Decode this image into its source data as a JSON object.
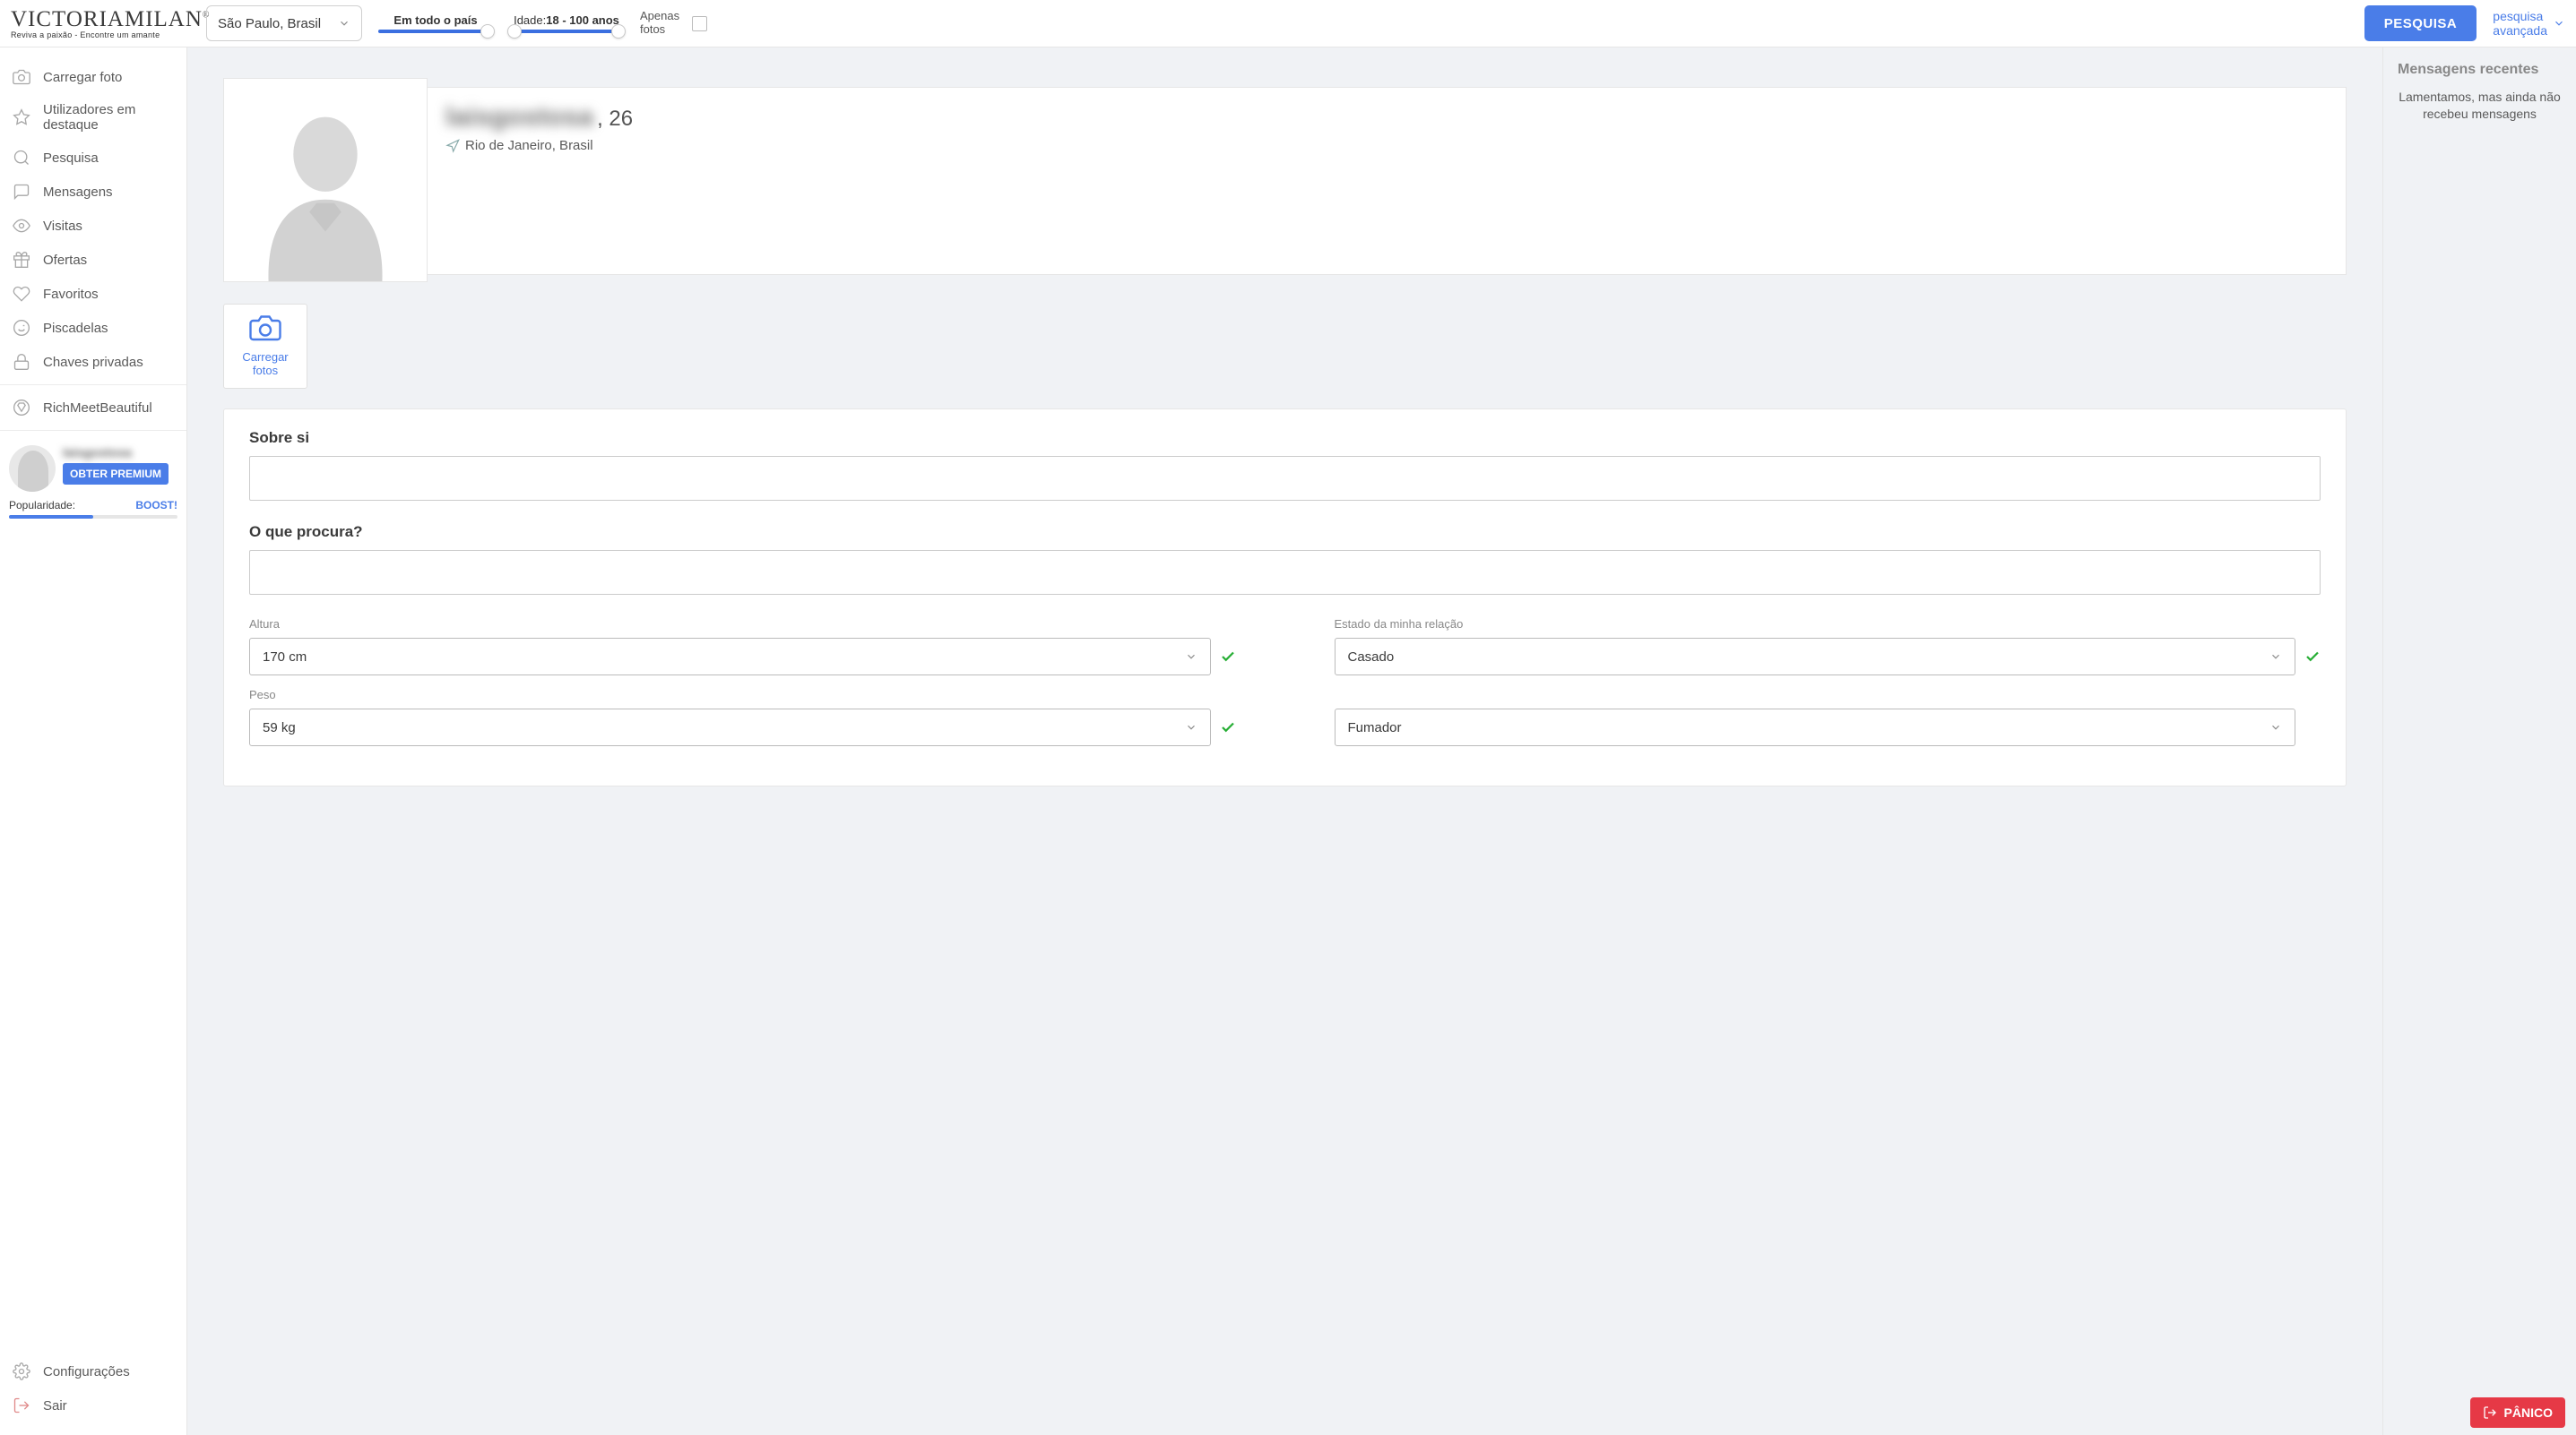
{
  "brand": {
    "name": "VICTORIAMILAN",
    "reg": "®",
    "tagline": "Reviva  a paixão - Encontre um amante"
  },
  "topbar": {
    "location": "São Paulo, Brasil",
    "range_label": "Em todo o país",
    "age_prefix": "Idade:",
    "age_value": "18 - 100 anos",
    "photos_only": "Apenas fotos",
    "search_btn": "PESQUISA",
    "adv_search_l1": "pesquisa",
    "adv_search_l2": "avançada"
  },
  "sidebar": {
    "items": [
      {
        "label": "Carregar foto",
        "icon": "camera"
      },
      {
        "label": "Utilizadores em destaque",
        "icon": "star"
      },
      {
        "label": "Pesquisa",
        "icon": "search"
      },
      {
        "label": "Mensagens",
        "icon": "chat"
      },
      {
        "label": "Visitas",
        "icon": "eye"
      },
      {
        "label": "Ofertas",
        "icon": "gift"
      },
      {
        "label": "Favoritos",
        "icon": "heart"
      },
      {
        "label": "Piscadelas",
        "icon": "wink"
      },
      {
        "label": "Chaves privadas",
        "icon": "lock"
      }
    ],
    "promo": {
      "label": "RichMeetBeautiful",
      "icon": "diamond"
    },
    "mini_name": "laisgostosa",
    "premium_btn": "OBTER PREMIUM",
    "pop_label": "Popularidade:",
    "boost": "BOOST!",
    "settings": "Configurações",
    "logout": "Sair"
  },
  "profile": {
    "username": "laisgostosa",
    "age_suffix": ", 26",
    "location": "Rio de Janeiro, Brasil",
    "upload_l1": "Carregar",
    "upload_l2": "fotos"
  },
  "form": {
    "about_label": "Sobre si",
    "lookingfor_label": "O que procura?",
    "height_label": "Altura",
    "height_value": "170 cm",
    "weight_label": "Peso",
    "weight_value": "59 kg",
    "relation_label": "Estado da minha relação",
    "relation_value": "Casado",
    "smoker_value": "Fumador"
  },
  "right": {
    "title": "Mensagens recentes",
    "empty": "Lamentamos, mas ainda não recebeu mensagens"
  },
  "panic": "PÂNICO"
}
